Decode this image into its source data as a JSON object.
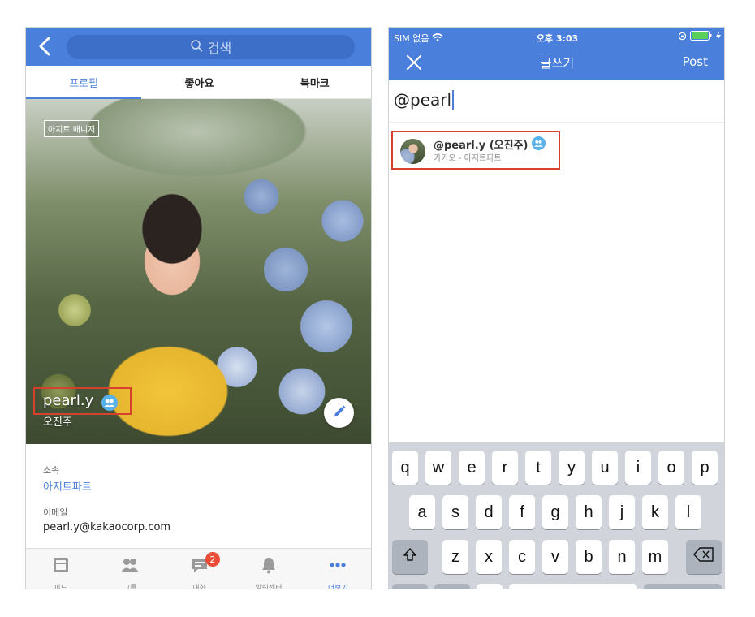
{
  "left": {
    "header": {
      "search_placeholder": "검색",
      "back_icon": "chevron-left-icon",
      "search_icon": "search-icon"
    },
    "tabs": [
      {
        "label": "프로필",
        "active": true
      },
      {
        "label": "좋아요",
        "active": false
      },
      {
        "label": "북마크",
        "active": false
      }
    ],
    "profile": {
      "badge": "아지트 매니저",
      "username": "pearl.y",
      "realname": "오진주",
      "user_icon": "group-user-icon",
      "edit_icon": "pencil-icon"
    },
    "info": {
      "dept_label": "소속",
      "dept_value": "아지트파트",
      "email_label": "이메일",
      "email_value": "pearl.y@kakaocorp.com"
    },
    "tabbar": [
      {
        "label": "피드",
        "icon": "feed-icon",
        "active": false
      },
      {
        "label": "그룹",
        "icon": "group-icon",
        "active": false
      },
      {
        "label": "대화",
        "icon": "chat-icon",
        "active": false,
        "badge": "2"
      },
      {
        "label": "알림센터",
        "icon": "bell-icon",
        "active": false
      },
      {
        "label": "더보기",
        "icon": "more-icon",
        "active": true
      }
    ],
    "colors": {
      "brand": "#4a7fdc",
      "highlight": "#d6402f",
      "badge": "#ea4e36"
    }
  },
  "right": {
    "status": {
      "carrier": "SIM 없음",
      "time": "오후 3:03"
    },
    "nav": {
      "title": "글쓰기",
      "post_label": "Post",
      "close_icon": "close-icon"
    },
    "compose": {
      "text": "@pearl"
    },
    "suggestion": {
      "name": "@pearl.y (오진주)",
      "sub": "카카오 - 아지트파트",
      "icon": "group-user-icon"
    },
    "keyboard": {
      "row1": [
        "q",
        "w",
        "e",
        "r",
        "t",
        "y",
        "u",
        "i",
        "o",
        "p"
      ],
      "row2": [
        "a",
        "s",
        "d",
        "f",
        "g",
        "h",
        "j",
        "k",
        "l"
      ],
      "row3": [
        "z",
        "x",
        "c",
        "v",
        "b",
        "n",
        "m"
      ]
    }
  }
}
